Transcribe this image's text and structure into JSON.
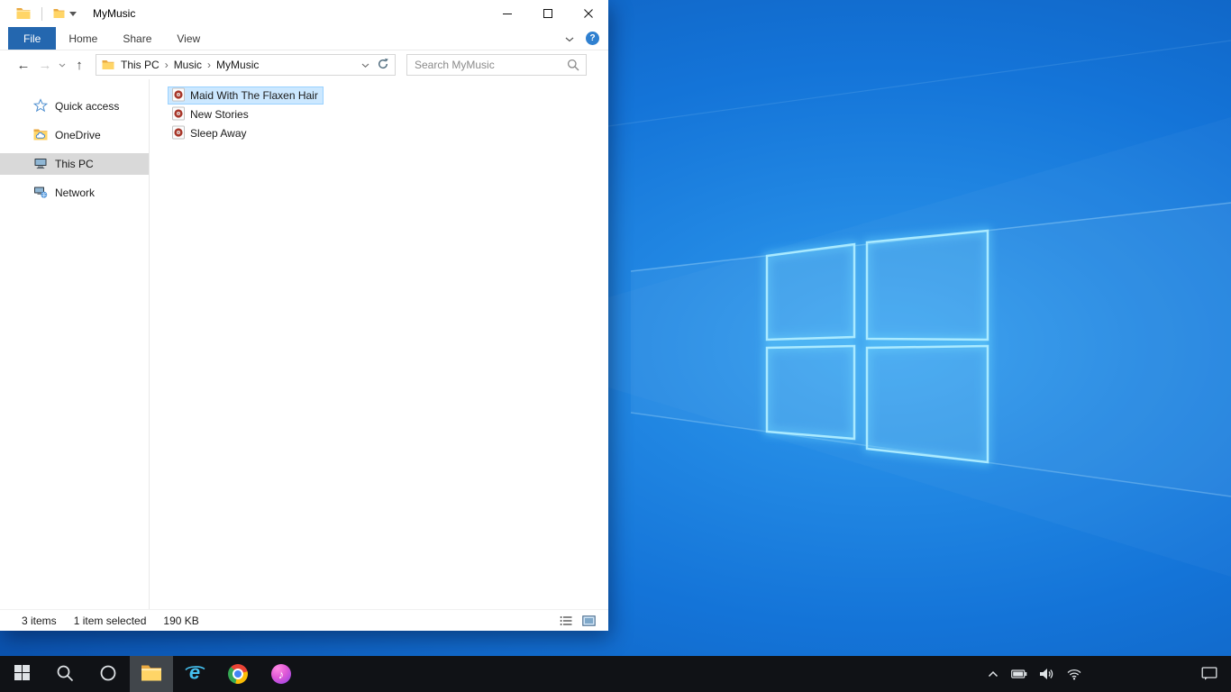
{
  "window": {
    "title": "MyMusic",
    "help_glyph": "?",
    "tabs": {
      "file": "File",
      "home": "Home",
      "share": "Share",
      "view": "View"
    },
    "nav": {
      "back": "←",
      "forward": "→",
      "up": "↑"
    },
    "breadcrumb": {
      "root": "This PC",
      "parent": "Music",
      "current": "MyMusic",
      "separator": "›"
    },
    "search": {
      "placeholder": "Search MyMusic"
    },
    "sidebar": {
      "items": [
        {
          "label": "Quick access",
          "icon": "star-icon",
          "selected": false
        },
        {
          "label": "OneDrive",
          "icon": "onedrive-folder-icon",
          "selected": false
        },
        {
          "label": "This PC",
          "icon": "computer-icon",
          "selected": true
        },
        {
          "label": "Network",
          "icon": "network-icon",
          "selected": false
        }
      ]
    },
    "files": [
      {
        "name": "Maid With The Flaxen Hair",
        "icon": "audio-file-icon",
        "selected": true
      },
      {
        "name": "New Stories",
        "icon": "audio-file-icon",
        "selected": false
      },
      {
        "name": "Sleep Away",
        "icon": "audio-file-icon",
        "selected": false
      }
    ],
    "status": {
      "count": "3 items",
      "selection": "1 item selected",
      "size": "190 KB"
    }
  },
  "colors": {
    "file_tab_blue": "#2467af",
    "selection_bg": "#cce8ff",
    "selection_border": "#99d1ff",
    "sidebar_selected_bg": "#d9d9d9",
    "taskbar_bg": "#101216",
    "wallpaper_logo": "#7fe3ff"
  },
  "taskbar": {
    "buttons": [
      {
        "name": "start",
        "icon": "windows-start-icon"
      },
      {
        "name": "search",
        "icon": "search-icon"
      },
      {
        "name": "cortana",
        "icon": "cortana-icon"
      },
      {
        "name": "file-explorer",
        "icon": "file-explorer-folder-icon",
        "active": true
      },
      {
        "name": "internet-explorer",
        "icon": "internet-explorer-icon",
        "glyph": "e"
      },
      {
        "name": "chrome",
        "icon": "chrome-icon"
      },
      {
        "name": "itunes",
        "icon": "itunes-icon",
        "glyph": "♪"
      }
    ],
    "tray": [
      {
        "name": "show-hidden-icons",
        "icon": "chevron-up-icon"
      },
      {
        "name": "battery",
        "icon": "battery-icon"
      },
      {
        "name": "volume",
        "icon": "volume-icon"
      },
      {
        "name": "network",
        "icon": "wifi-icon"
      },
      {
        "name": "action-center",
        "icon": "action-center-icon"
      }
    ]
  }
}
